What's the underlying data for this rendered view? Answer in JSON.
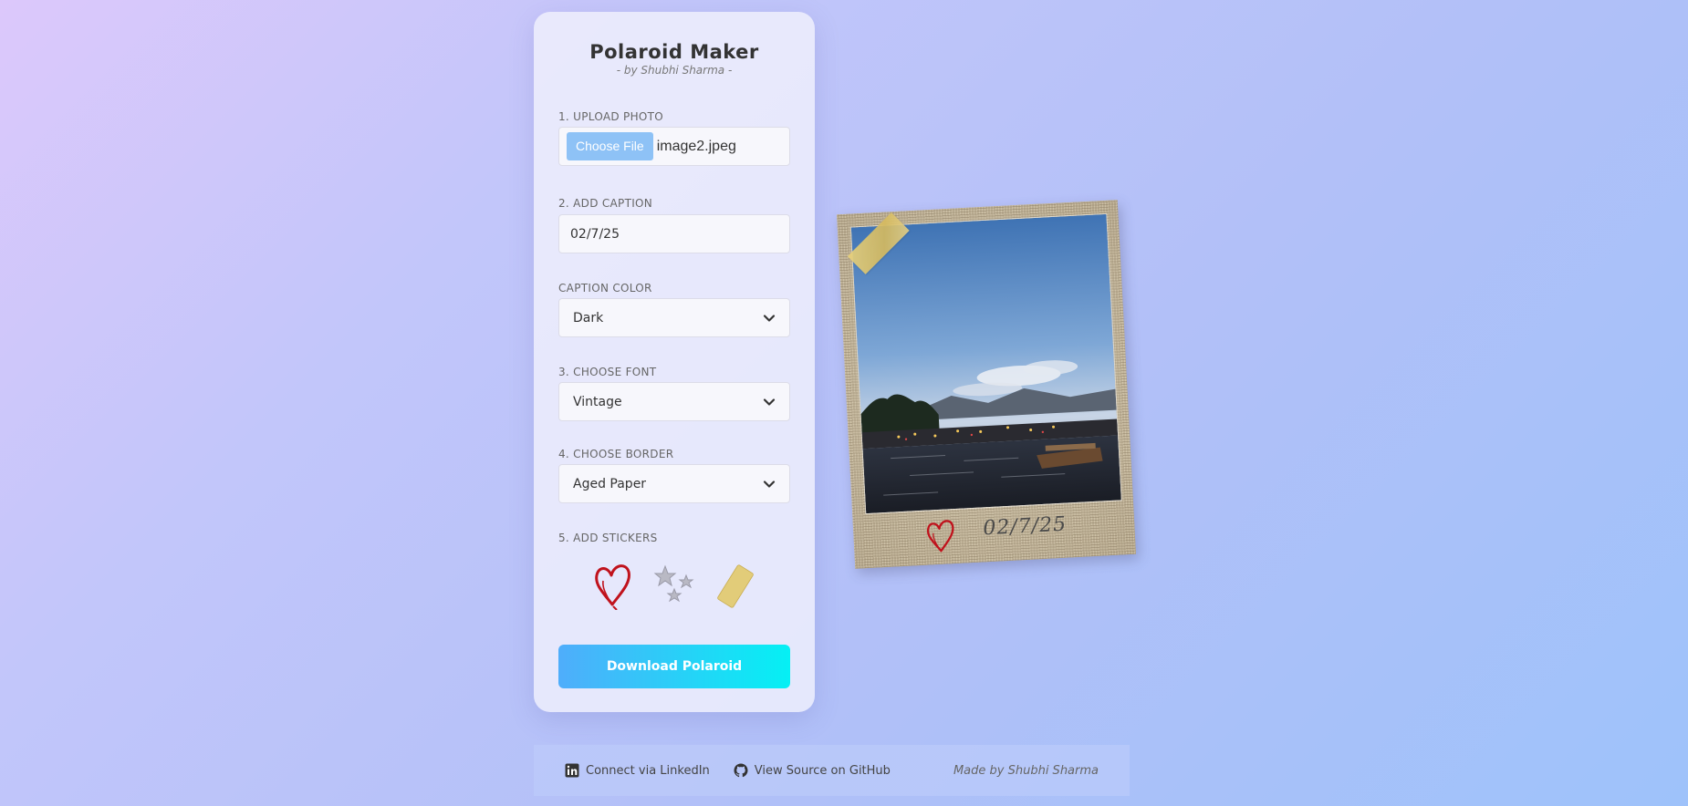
{
  "app": {
    "title": "Polaroid Maker",
    "subtitle": "- by Shubhi Sharma -"
  },
  "upload": {
    "label": "1. UPLOAD PHOTO",
    "button_label": "Choose File",
    "file_name": "image2.jpeg"
  },
  "caption": {
    "label": "2. ADD CAPTION",
    "value": "02/7/25"
  },
  "caption_color": {
    "label": "CAPTION COLOR",
    "selected": "Dark"
  },
  "font": {
    "label": "3. CHOOSE FONT",
    "selected": "Vintage"
  },
  "border": {
    "label": "4. CHOOSE BORDER",
    "selected": "Aged Paper"
  },
  "stickers": {
    "label": "5. ADD STICKERS",
    "items": [
      "heart-sticker",
      "stars-sticker",
      "tape-sticker"
    ]
  },
  "download": {
    "label": "Download Polaroid"
  },
  "preview": {
    "caption_text": "02/7/25"
  },
  "footer": {
    "linkedin_label": "Connect via LinkedIn",
    "github_label": "View Source on GitHub",
    "made_by": "Made by Shubhi Sharma"
  },
  "colors": {
    "accent_start": "#4fadfb",
    "accent_end": "#05f0f4",
    "file_button": "#8ec2f6",
    "heart": "#c0121c"
  }
}
